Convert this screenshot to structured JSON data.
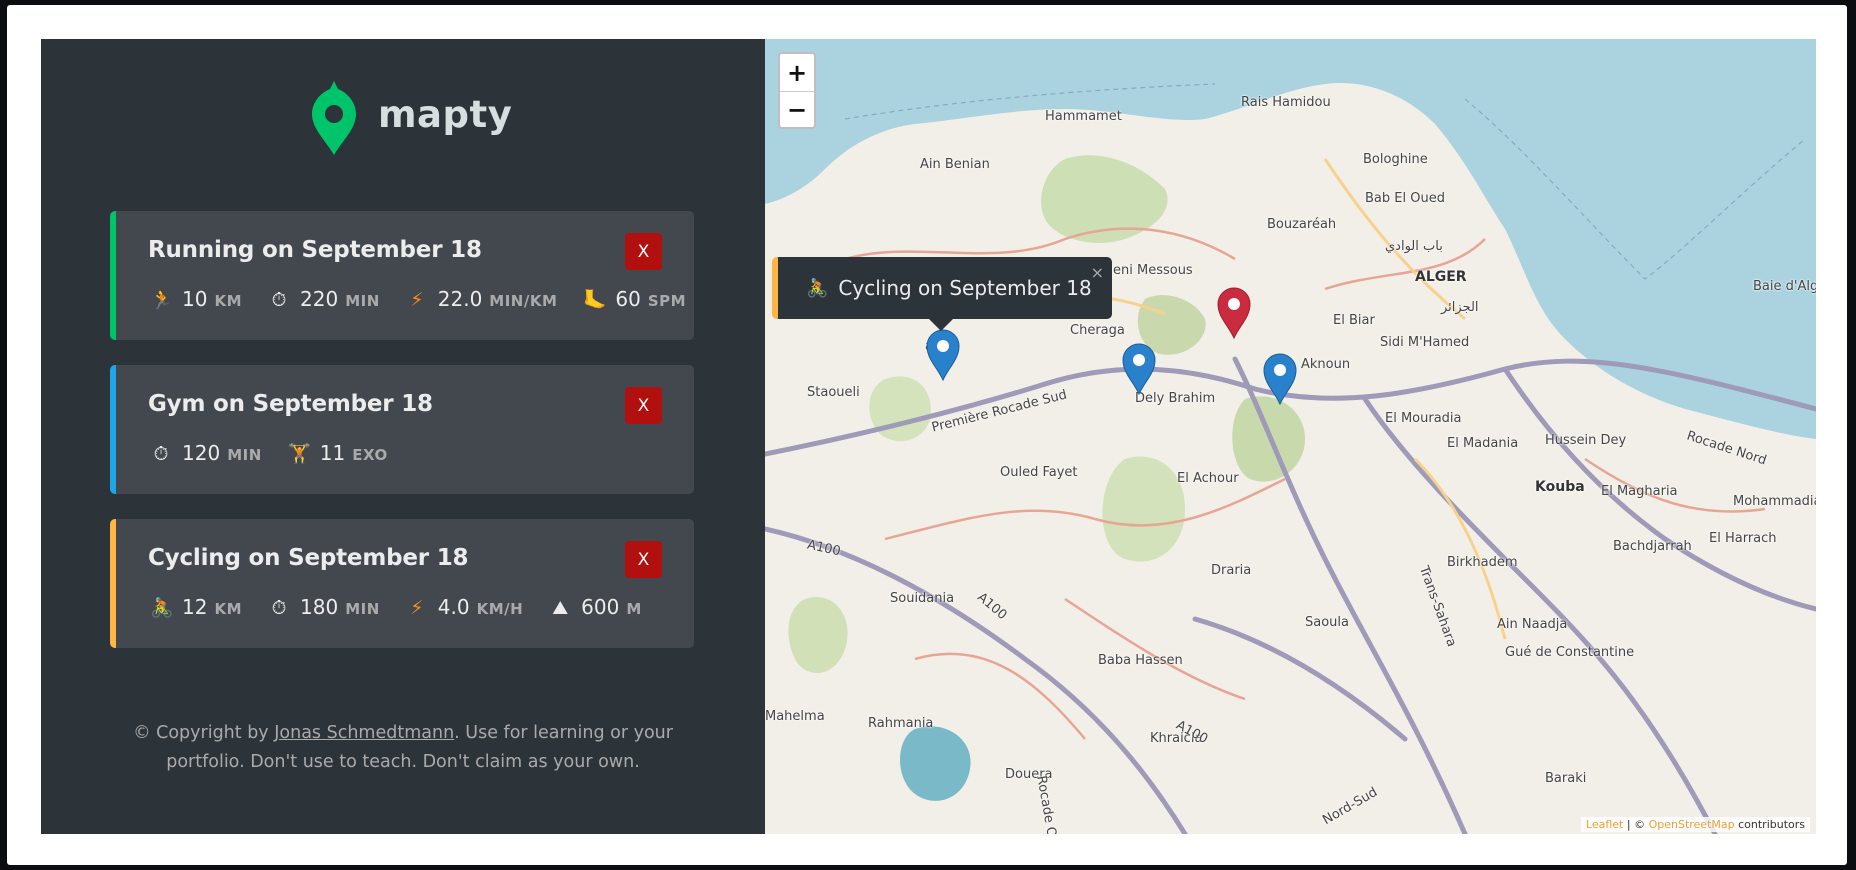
{
  "app": {
    "name": "mapty"
  },
  "workouts": [
    {
      "title": "Running on September 18",
      "delete_label": "X",
      "details": [
        {
          "icon": "🏃",
          "value": "10",
          "unit": "KM"
        },
        {
          "icon": "⏱",
          "value": "220",
          "unit": "MIN"
        },
        {
          "icon": "⚡",
          "value": "22.0",
          "unit": "MIN/KM"
        },
        {
          "icon": "🦶",
          "value": "60",
          "unit": "SPM"
        }
      ]
    },
    {
      "title": "Gym on September 18",
      "delete_label": "X",
      "details": [
        {
          "icon": "⏱",
          "value": "120",
          "unit": "MIN"
        },
        {
          "icon": "🏋",
          "value": "11",
          "unit": "EXO"
        }
      ]
    },
    {
      "title": "Cycling on September 18",
      "delete_label": "X",
      "details": [
        {
          "icon": "🚴",
          "value": "12",
          "unit": "KM"
        },
        {
          "icon": "⏱",
          "value": "180",
          "unit": "MIN"
        },
        {
          "icon": "⚡",
          "value": "4.0",
          "unit": "KM/H"
        },
        {
          "icon": "⛰",
          "value": "600",
          "unit": "M"
        }
      ]
    }
  ],
  "copyright": {
    "prefix": "© Copyright by ",
    "author": "Jonas Schmedtmann",
    "suffix": ". Use for learning or your portfolio. Don't use to teach. Don't claim as your own."
  },
  "map": {
    "zoom_in": "+",
    "zoom_out": "−",
    "popup": {
      "icon": "🚴",
      "text": "Cycling on September 18",
      "close": "×"
    },
    "places": {
      "hammamet": "Hammamet",
      "rais_hamidou": "Rais Hamidou",
      "ain_benian": "Ain Benian",
      "bologhine": "Bologhine",
      "bab_el_oued": "Bab El Oued",
      "bab_el_oued_ar": "باب الوادي",
      "bouzareah": "Bouzaréah",
      "beni_messous": "eni Messous",
      "alger": "ALGER",
      "alger_ar": "الجزائر",
      "el_biar": "El Biar",
      "cheraga": "Cheraga",
      "sidi_mhamed": "Sidi M'Hamed",
      "staoueli": "Staoueli",
      "ouled_fayet": "Ouled Fayet",
      "dely_brahim": "Dely Brahim",
      "aknoun": "Aknoun",
      "el_mouradia": "El Mouradia",
      "el_madania": "El Madania",
      "hussein_dey": "Hussein Dey",
      "kouba": "Kouba",
      "el_magharia": "El Magharia",
      "mohammadia": "Mohammadia",
      "bachdjarrah": "Bachdjarrah",
      "el_harrach": "El Harrach",
      "el_achour": "El Achour",
      "draria": "Draria",
      "birkhadem": "Birkhadem",
      "souidania": "Souidania",
      "saoula": "Saoula",
      "ain_naadja": "Ain Naadja",
      "gue_de_constantine": "Gué de Constantine",
      "baba_hassen": "Baba Hassen",
      "mahelma": "Mahelma",
      "rahmania": "Rahmania",
      "khraicia": "Khraicia",
      "douera": "Douera",
      "baraki": "Baraki",
      "baie": "Baie d'Alge",
      "premiere_rocade": "Première Rocade Sud",
      "rocade_nord": "Rocade Nord",
      "a100_a": "A100",
      "a100_b": "A100",
      "a100_c": "A100",
      "trans_sahara": "Trans-Sahara",
      "nord_sud": "Nord-Sud",
      "rocade_o": "Rocade O",
      "ria": "aria"
    },
    "attribution": {
      "leaflet": "Leaflet",
      "sep": " | © ",
      "osm": "OpenStreetMap",
      "suffix": " contributors"
    }
  },
  "colors": {
    "running": "#00c46a",
    "gym": "#1ea7e8",
    "cycling": "#ffb545",
    "delete": "#b20f0f",
    "marker_blue": "#2a81cb",
    "marker_red": "#cb2b3e"
  }
}
